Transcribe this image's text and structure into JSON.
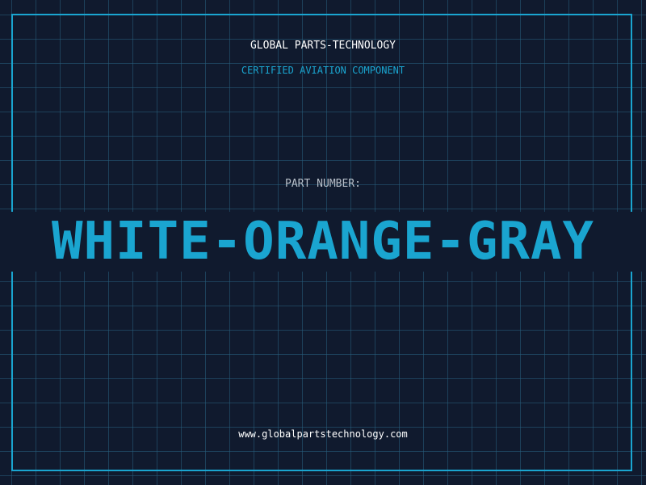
{
  "header": {
    "company": "GLOBAL PARTS-TECHNOLOGY",
    "subtitle": "CERTIFIED AVIATION COMPONENT"
  },
  "part": {
    "label": "PART NUMBER:",
    "number": "WHITE-ORANGE-GRAY"
  },
  "footer": {
    "website": "www.globalpartstechnology.com"
  },
  "colors": {
    "background": "#101a2e",
    "grid": "#285f7d",
    "accent": "#1aa5d0",
    "text_primary": "#ffffff",
    "text_muted": "#b7bfc9"
  }
}
